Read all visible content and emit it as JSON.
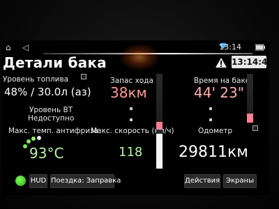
{
  "status_bar": {
    "time": "13:14",
    "icons": [
      "home-icon",
      "back-icon",
      "wifi-icon",
      "battery-icon"
    ]
  },
  "header": {
    "title": "Детали бака",
    "clock": "13:14:41",
    "warning_icon": "warning-icon"
  },
  "fuel": {
    "label": "Уровень топлива",
    "value": "48% / 30.0л (аз)"
  },
  "range": {
    "label": "Запас хода",
    "value": "38км",
    "level": 0.22
  },
  "time_on_tank": {
    "label": "Время на баке",
    "value": "44' 23\"",
    "level": 0.18
  },
  "vt_level": {
    "label": "Уровень ВТ",
    "value": "Недоступно"
  },
  "coolant": {
    "label": "Макс. темп. антифриза",
    "value": "93°C"
  },
  "max_speed": {
    "label": "Макс. скорость (км/ч)",
    "value": "118",
    "level": 0.9
  },
  "odometer": {
    "label": "Одометр",
    "value": "29811км"
  },
  "bottom": {
    "hud": "HUD",
    "trip": "Поездка: Заправка",
    "actions": "Действия",
    "screens": "Экраны"
  },
  "colors": {
    "accent_red": "#ff9a9a",
    "accent_green": "#b9f5a8",
    "bar_fill": "#ff7e8f"
  }
}
